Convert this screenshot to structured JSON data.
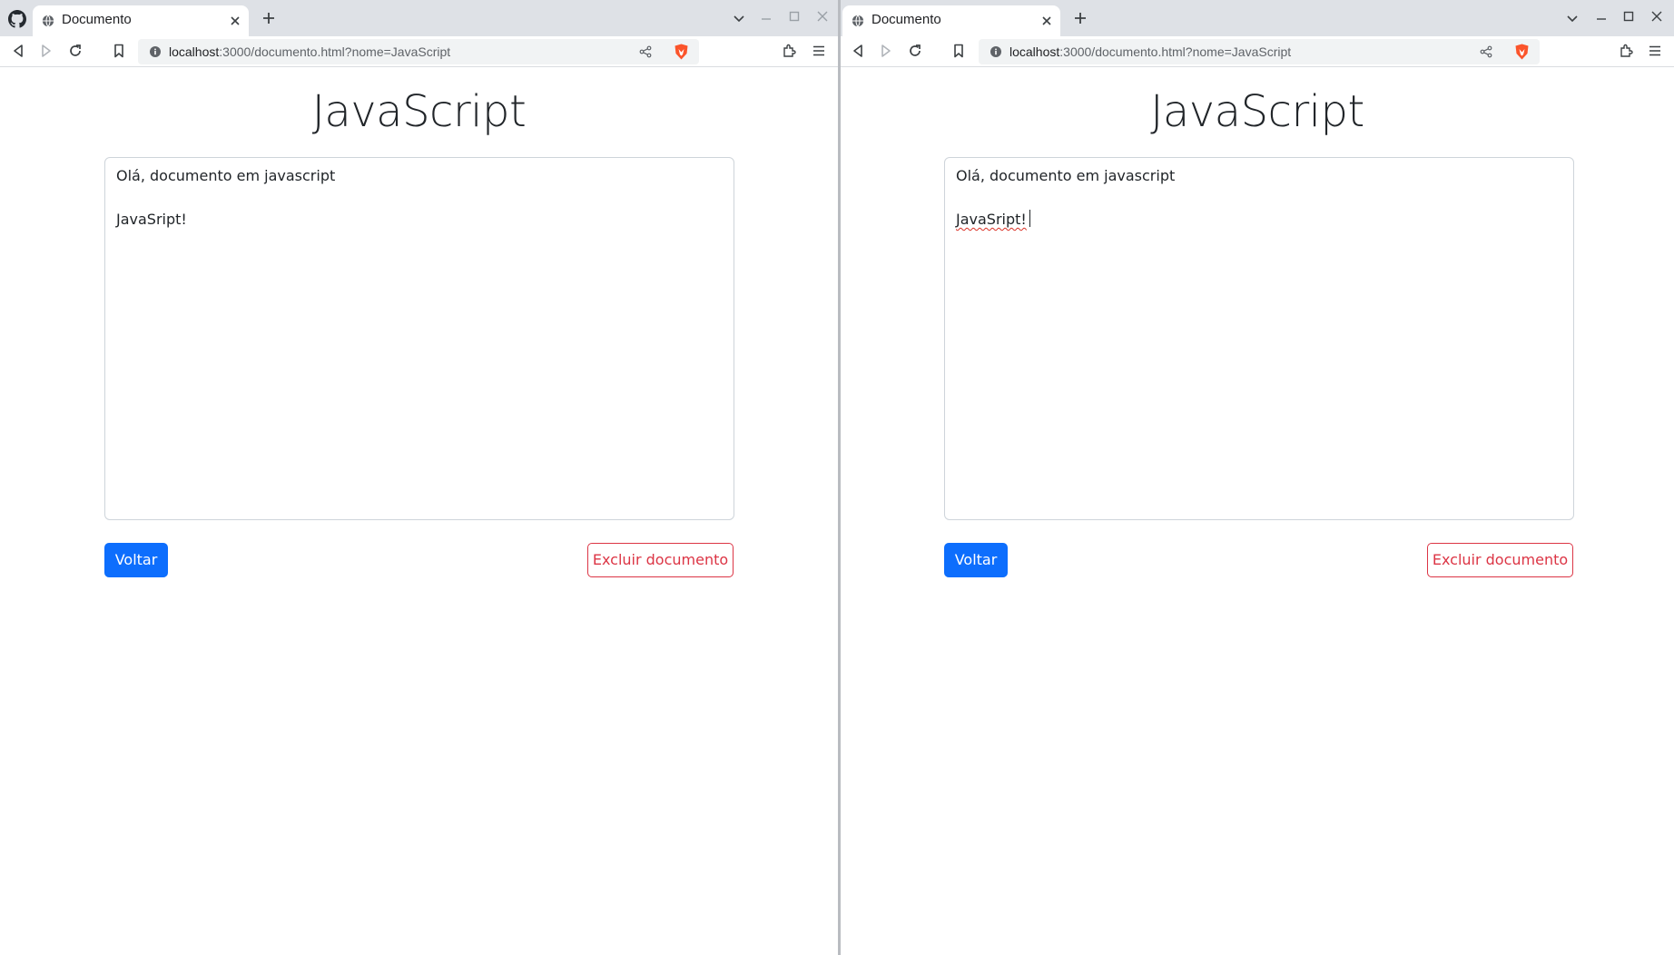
{
  "windows": [
    {
      "tab": {
        "title": "Documento"
      },
      "address": {
        "host": "localhost",
        "rest": ":3000/documento.html?nome=JavaScript"
      },
      "page": {
        "title": "JavaScript",
        "editor_lines": [
          "Olá, documento em javascript",
          "",
          "JavaSript!"
        ],
        "back_label": "Voltar",
        "delete_label": "Excluir documento"
      }
    },
    {
      "tab": {
        "title": "Documento"
      },
      "address": {
        "host": "localhost",
        "rest": ":3000/documento.html?nome=JavaScript"
      },
      "page": {
        "title": "JavaScript",
        "editor_lines": [
          "Olá, documento em javascript",
          "",
          "JavaSript!"
        ],
        "back_label": "Voltar",
        "delete_label": "Excluir documento"
      }
    }
  ],
  "colors": {
    "primary": "#0d6efd",
    "danger": "#dc3545",
    "tabstrip": "#dee1e6",
    "brave": "#fb542b"
  },
  "icons": {
    "toolbar": [
      "back-icon",
      "forward-icon",
      "reload-icon",
      "bookmark-icon",
      "info-icon",
      "share-icon",
      "brave-shield-icon",
      "extensions-icon",
      "menu-icon"
    ],
    "tabstrip": [
      "github-icon",
      "globe-icon",
      "close-icon",
      "new-tab-icon",
      "tab-search-icon",
      "minimize-icon",
      "maximize-icon",
      "window-close-icon"
    ]
  }
}
